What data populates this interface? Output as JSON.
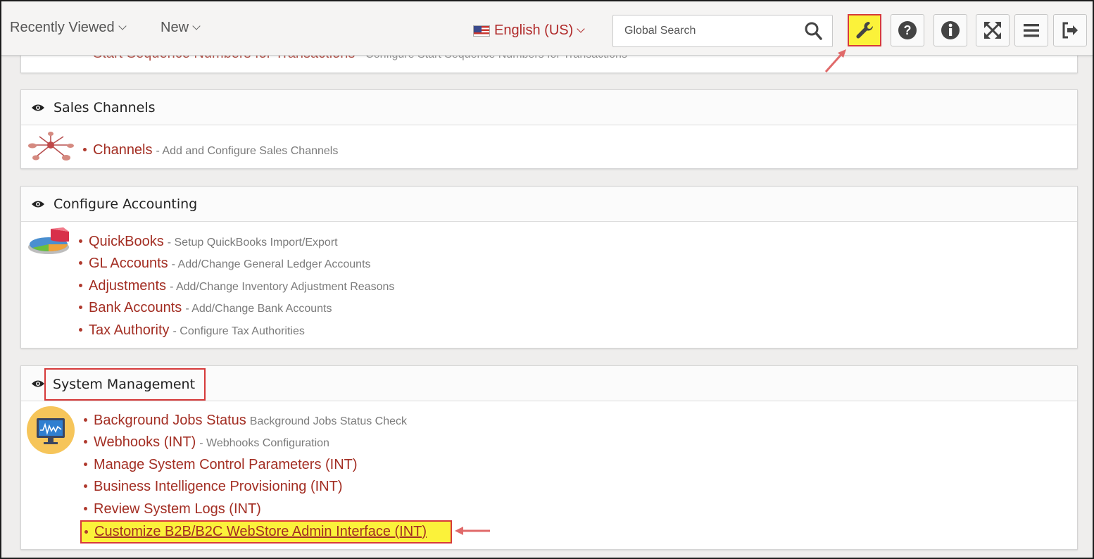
{
  "header": {
    "recently_viewed": "Recently Viewed",
    "new_label": "New",
    "language": "English (US)",
    "search_placeholder": "Global Search",
    "colors": {
      "accent": "#a32e23",
      "highlight": "#fbf23a",
      "callout": "#d63a3a"
    },
    "tools": [
      {
        "icon": "wrench-icon",
        "active": true
      },
      {
        "icon": "help-icon"
      },
      {
        "icon": "info-icon"
      },
      {
        "icon": "fullscreen-icon"
      },
      {
        "icon": "menu-icon"
      },
      {
        "icon": "logout-icon"
      }
    ]
  },
  "partial_section": {
    "link": "Start Sequence Numbers for Transactions",
    "desc": "- Configure Start Sequence Numbers for Transactions"
  },
  "sections": {
    "sales": {
      "title": "Sales Channels",
      "items": [
        {
          "link": "Channels",
          "desc": "- Add and Configure Sales Channels"
        }
      ]
    },
    "accounting": {
      "title": "Configure Accounting",
      "items": [
        {
          "link": "QuickBooks",
          "desc": "- Setup QuickBooks Import/Export"
        },
        {
          "link": "GL Accounts",
          "desc": "- Add/Change General Ledger Accounts"
        },
        {
          "link": "Adjustments",
          "desc": "- Add/Change Inventory Adjustment Reasons"
        },
        {
          "link": "Bank Accounts",
          "desc": "- Add/Change Bank Accounts"
        },
        {
          "link": "Tax Authority",
          "desc": "- Configure Tax Authorities"
        }
      ]
    },
    "system": {
      "title": "System Management",
      "items": [
        {
          "link": "Background Jobs Status",
          "desc": "Background Jobs Status Check"
        },
        {
          "link": "Webhooks (INT)",
          "desc": "- Webhooks Configuration"
        },
        {
          "link": "Manage System Control Parameters (INT)",
          "desc": ""
        },
        {
          "link": "Business Intelligence Provisioning (INT)",
          "desc": ""
        },
        {
          "link": "Review System Logs (INT)",
          "desc": ""
        },
        {
          "link": "Customize B2B/B2C WebStore Admin Interface (INT)",
          "desc": ""
        }
      ]
    }
  }
}
